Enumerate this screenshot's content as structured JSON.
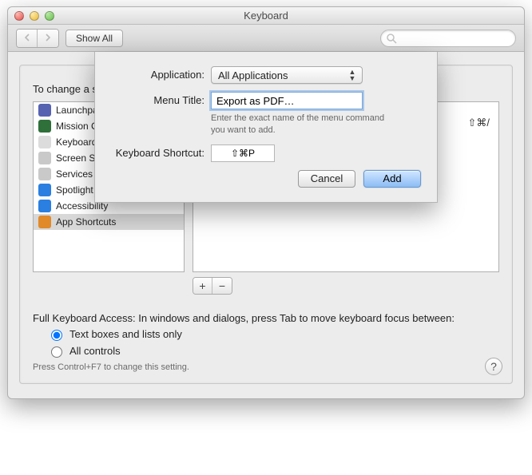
{
  "window_title": "Keyboard",
  "toolbar": {
    "show_all_label": "Show All",
    "search_placeholder": ""
  },
  "panel": {
    "instruction": "To change a shortcut, select it, click the key combination, and then type the new keys.",
    "existing_shortcut": "⇧⌘/",
    "sidebar": [
      {
        "label": "Launchpad & Dock",
        "icon_name": "launchpad-icon",
        "bg": "#5563b0"
      },
      {
        "label": "Mission Control",
        "icon_name": "mission-control-icon",
        "bg": "#2f6f3a"
      },
      {
        "label": "Keyboard",
        "icon_name": "keyboard-icon",
        "bg": "#dcdcdc"
      },
      {
        "label": "Screen Shots",
        "icon_name": "screenshots-icon",
        "bg": "#c9c9c9"
      },
      {
        "label": "Services",
        "icon_name": "services-icon",
        "bg": "#c9c9c9"
      },
      {
        "label": "Spotlight",
        "icon_name": "spotlight-icon",
        "bg": "#2a7fe0"
      },
      {
        "label": "Accessibility",
        "icon_name": "accessibility-icon",
        "bg": "#2a7fe0"
      },
      {
        "label": "App Shortcuts",
        "icon_name": "app-shortcuts-icon",
        "bg": "#e08a2a",
        "selected": true
      }
    ],
    "fka_label": "Full Keyboard Access: In windows and dialogs, press Tab to move keyboard focus between:",
    "radio1": "Text boxes and lists only",
    "radio2": "All controls",
    "hint": "Press Control+F7 to change this setting."
  },
  "sheet": {
    "application_label": "Application:",
    "application_value": "All Applications",
    "menu_title_label": "Menu Title:",
    "menu_title_value": "Export as PDF…",
    "menu_title_help": "Enter the exact name of the menu command you want to add.",
    "shortcut_label": "Keyboard Shortcut:",
    "shortcut_value": "⇧⌘P",
    "cancel_label": "Cancel",
    "add_label": "Add"
  }
}
